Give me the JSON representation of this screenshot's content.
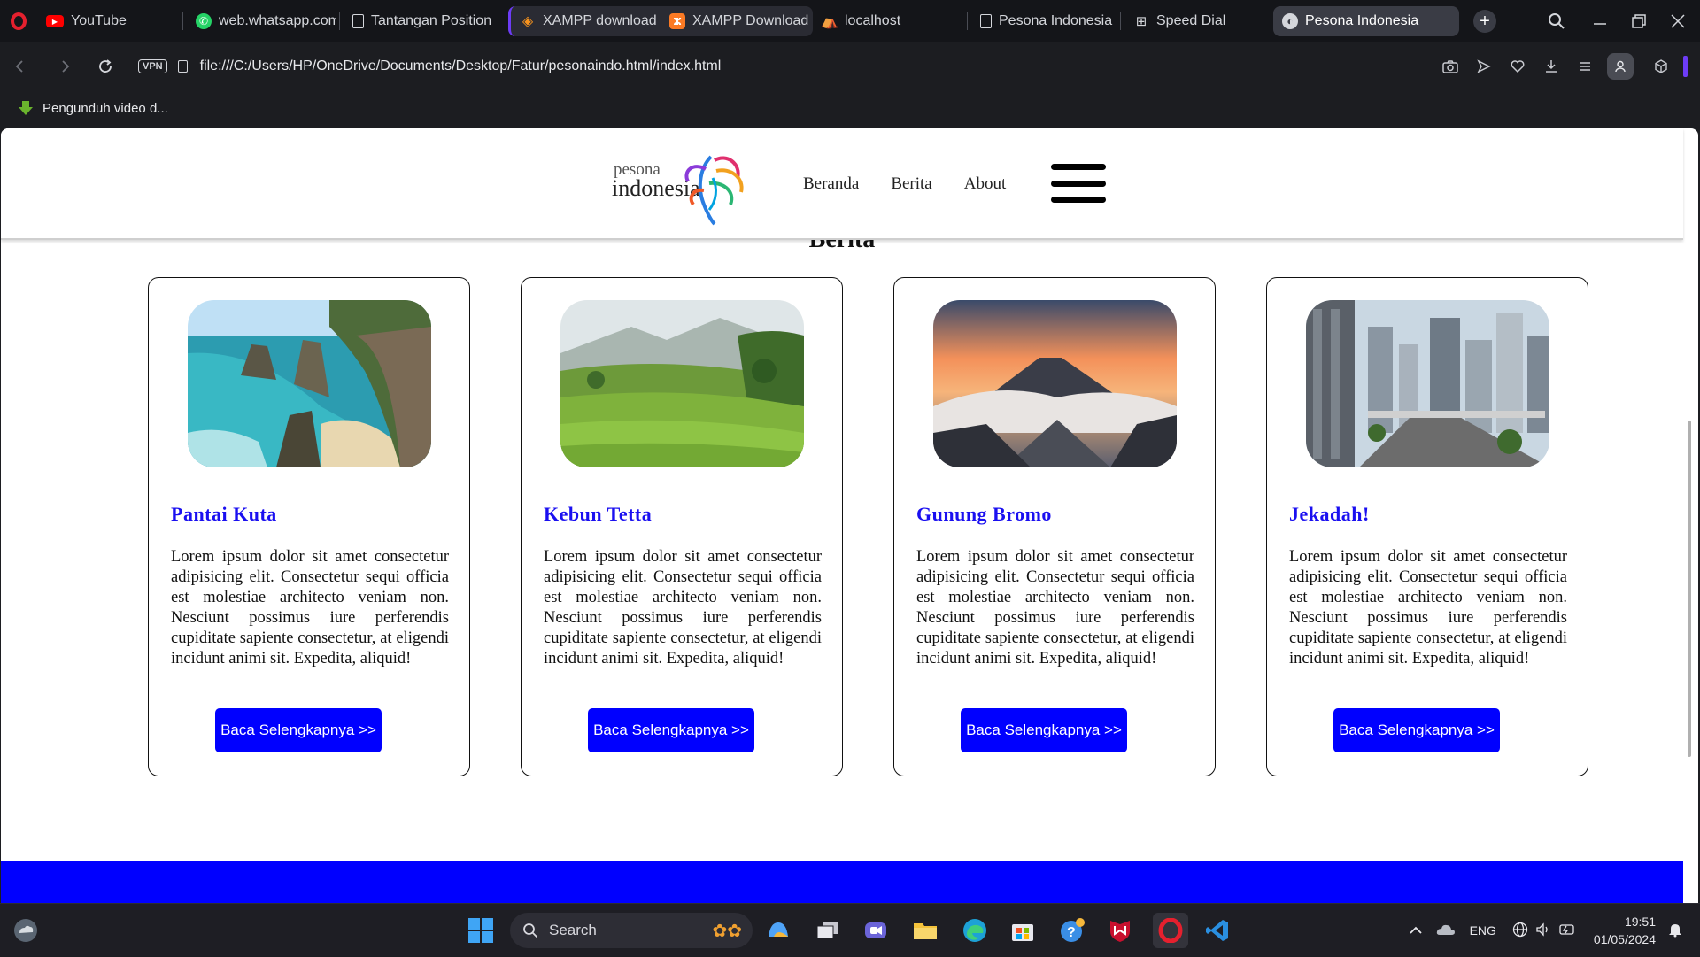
{
  "browser": {
    "tabs": [
      {
        "label": "YouTube",
        "icon": "youtube-icon",
        "color": "#ff0000"
      },
      {
        "label": "web.whatsapp.com",
        "icon": "whatsapp-icon",
        "color": "#25d366"
      },
      {
        "label": "Tantangan Position",
        "icon": "document-icon",
        "color": "#d4d6db"
      },
      {
        "label": "XAMPP download | S",
        "icon": "xampp-diamond-icon",
        "color": "#f7931e"
      },
      {
        "label": "XAMPP Download S",
        "icon": "xampp-icon",
        "color": "#fb7a24"
      },
      {
        "label": "localhost",
        "icon": "xampp-logo-icon",
        "color": "#f08c28"
      },
      {
        "label": "Pesona Indonesia",
        "icon": "document-icon",
        "color": "#d4d6db"
      },
      {
        "label": "Speed Dial",
        "icon": "grid-icon",
        "color": "#d4d6db"
      },
      {
        "label": "Pesona Indonesia",
        "icon": "globe-icon",
        "color": "#d4d6db"
      }
    ],
    "address": {
      "vpn_label": "VPN",
      "url": "file:///C:/Users/HP/OneDrive/Documents/Desktop/Fatur/pesonaindo.html/index.html"
    },
    "bookmark": {
      "label": "Pengunduh video d..."
    }
  },
  "site": {
    "logo": {
      "top_text": "pesona",
      "main_text": "indonesia"
    },
    "nav": {
      "home": "Beranda",
      "news": "Berita",
      "about": "About"
    },
    "section_title": "Berita",
    "cards": [
      {
        "title": "Pantai Kuta",
        "image": "beach-cliff-photo",
        "body": "Lorem ipsum dolor sit amet consectetur adipisicing elit. Consectetur sequi officia est molestiae architecto veniam non. Nesciunt possimus iure perferendis cupiditate sapiente consectetur, at eligendi incidunt animi sit. Expedita, aliquid!",
        "button": "Baca Selengkapnya >>"
      },
      {
        "title": "Kebun Tetta",
        "image": "rice-terrace-photo",
        "body": "Lorem ipsum dolor sit amet consectetur adipisicing elit. Consectetur sequi officia est molestiae architecto veniam non. Nesciunt possimus iure perferendis cupiditate sapiente consectetur, at eligendi incidunt animi sit. Expedita, aliquid!",
        "button": "Baca Selengkapnya >>"
      },
      {
        "title": "Gunung Bromo",
        "image": "volcano-sunrise-photo",
        "body": "Lorem ipsum dolor sit amet consectetur adipisicing elit. Consectetur sequi officia est molestiae architecto veniam non. Nesciunt possimus iure perferendis cupiditate sapiente consectetur, at eligendi incidunt animi sit. Expedita, aliquid!",
        "button": "Baca Selengkapnya >>"
      },
      {
        "title": "Jekadah!",
        "image": "city-skyline-photo",
        "body": "Lorem ipsum dolor sit amet consectetur adipisicing elit. Consectetur sequi officia est molestiae architecto veniam non. Nesciunt possimus iure perferendis cupiditate sapiente consectetur, at eligendi incidunt animi sit. Expedita, aliquid!",
        "button": "Baca Selengkapnya >>"
      }
    ],
    "colors": {
      "accent": "#0000ff",
      "title": "#1a0ff0"
    }
  },
  "taskbar": {
    "search_label": "Search",
    "language": "ENG",
    "time": "19:51",
    "date": "01/05/2024"
  }
}
